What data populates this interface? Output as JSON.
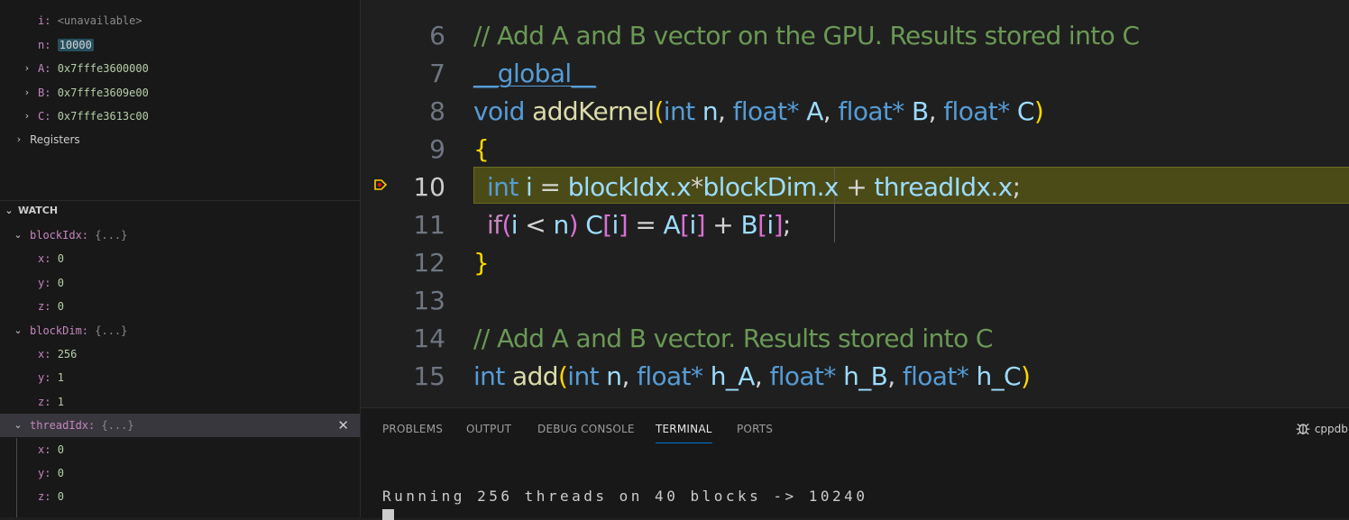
{
  "sidebar": {
    "locals": [
      {
        "name": "i",
        "value": "<unavailable>"
      },
      {
        "name": "n",
        "value": "10000"
      },
      {
        "name": "A",
        "value": "0x7fffe3600000"
      },
      {
        "name": "B",
        "value": "0x7fffe3609e00"
      },
      {
        "name": "C",
        "value": "0x7fffe3613c00"
      }
    ],
    "registers_label": "Registers",
    "watch": {
      "title": "WATCH",
      "items": [
        {
          "name": "blockIdx",
          "summary": "{...}",
          "children": [
            {
              "name": "x",
              "value": "0"
            },
            {
              "name": "y",
              "value": "0"
            },
            {
              "name": "z",
              "value": "0"
            }
          ]
        },
        {
          "name": "blockDim",
          "summary": "{...}",
          "children": [
            {
              "name": "x",
              "value": "256"
            },
            {
              "name": "y",
              "value": "1"
            },
            {
              "name": "z",
              "value": "1"
            }
          ]
        },
        {
          "name": "threadIdx",
          "summary": "{...}",
          "children": [
            {
              "name": "x",
              "value": "0"
            },
            {
              "name": "y",
              "value": "0"
            },
            {
              "name": "z",
              "value": "0"
            }
          ]
        }
      ]
    }
  },
  "editor": {
    "line_numbers": [
      "6",
      "7",
      "8",
      "9",
      "10",
      "11",
      "12",
      "13",
      "14",
      "15"
    ],
    "current_line": "10",
    "code": {
      "l6_comment": "// Add A and B vector on the GPU. Results stored into C",
      "l7_macro": "__global__",
      "l8": {
        "void": "void",
        "name": "addKernel",
        "open": "(",
        "t1": "int",
        "p1": "n",
        "c1": ",",
        "t2": "float*",
        "p2": "A",
        "c2": ",",
        "t3": "float*",
        "p3": "B",
        "c3": ",",
        "t4": "float*",
        "p4": "C",
        "close": ")"
      },
      "l9": "{",
      "l10": {
        "t": "int",
        "v": "i",
        "eq": "=",
        "a": "blockIdx.x",
        "mul": "*",
        "b": "blockDim.x",
        "plus": "+",
        "c": "threadIdx.x",
        "end": ";"
      },
      "l11": {
        "kw": "if",
        "open": "(",
        "i": "i",
        "lt": "<",
        "n": "n",
        "close": ")",
        "C": "C",
        "b1o": "[",
        "i1": "i",
        "b1c": "]",
        "eq": "=",
        "A": "A",
        "b2o": "[",
        "i2": "i",
        "b2c": "]",
        "plus": "+",
        "B": "B",
        "b3o": "[",
        "i3": "i",
        "b3c": "]",
        "end": ";"
      },
      "l12": "}",
      "l14_comment": "// Add A and B vector. Results stored into C",
      "l15": {
        "t": "int",
        "name": "add",
        "open": "(",
        "t1": "int",
        "p1": "n",
        "c1": ",",
        "t2": "float*",
        "p2": "h_A",
        "c2": ",",
        "t3": "float*",
        "p3": "h_B",
        "c3": ",",
        "t4": "float*",
        "p4": "h_C",
        "close": ")"
      }
    }
  },
  "panel": {
    "tabs": [
      "PROBLEMS",
      "OUTPUT",
      "DEBUG CONSOLE",
      "TERMINAL",
      "PORTS"
    ],
    "active_tab": "TERMINAL",
    "session": "cppdb",
    "terminal_output": "Running 256 threads on 40 blocks -> 10240"
  },
  "colors": {
    "comment": "#6a9955",
    "keyword": "#569cd6",
    "function": "#dcdcaa",
    "variable": "#9cdcfe",
    "stopped_line_bg": "#4b4b18",
    "accent": "#0078d4"
  }
}
